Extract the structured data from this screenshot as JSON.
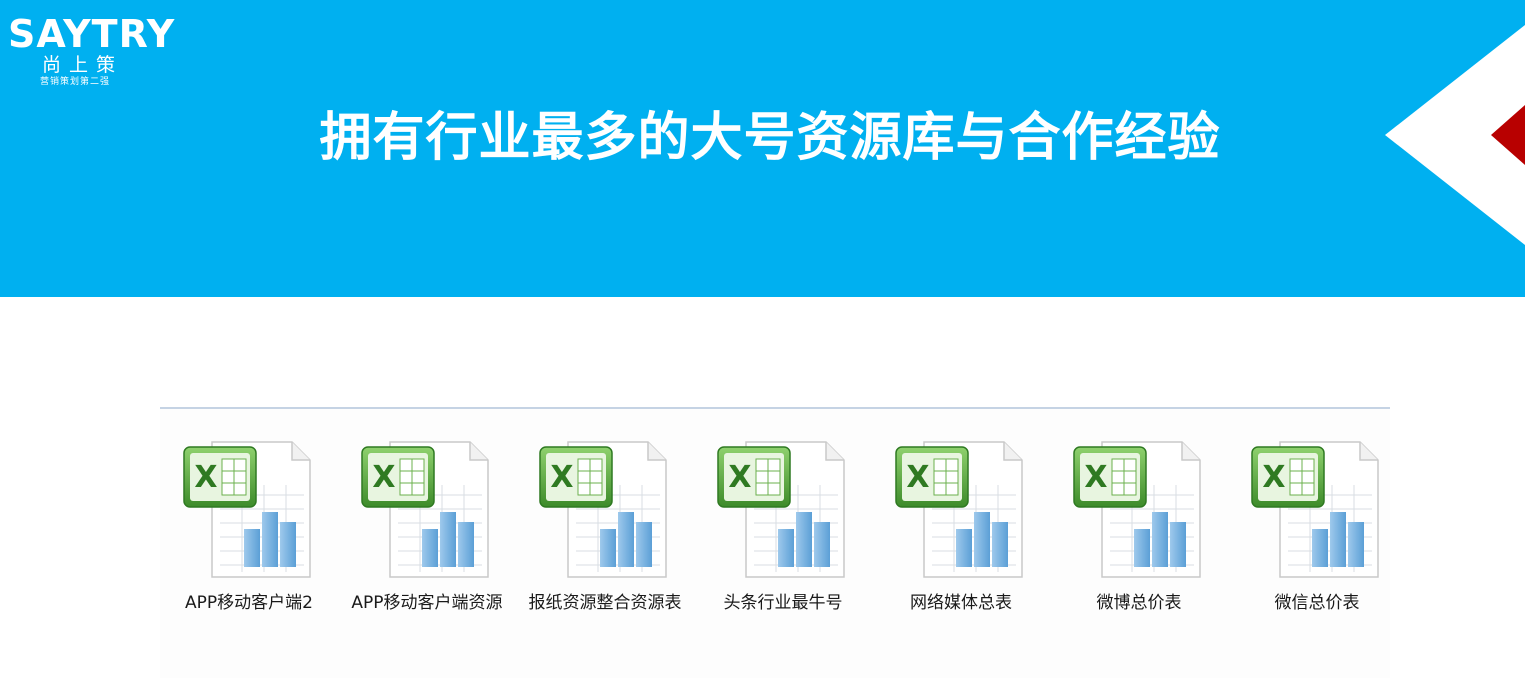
{
  "logo": {
    "brand": "SAYTRY",
    "cn": "尚上策",
    "sub": "营销策划第二强"
  },
  "title": "拥有行业最多的大号资源库与合作经验",
  "colors": {
    "banner": "#00b0f0",
    "accent_red": "#b80000"
  },
  "files": [
    {
      "label": "APP移动客户端2",
      "icon": "excel-file-icon"
    },
    {
      "label": "APP移动客户端资源",
      "icon": "excel-file-icon"
    },
    {
      "label": "报纸资源整合资源表",
      "icon": "excel-file-icon"
    },
    {
      "label": "头条行业最牛号",
      "icon": "excel-file-icon"
    },
    {
      "label": "网络媒体总表",
      "icon": "excel-file-icon"
    },
    {
      "label": "微博总价表",
      "icon": "excel-file-icon"
    },
    {
      "label": "微信总价表",
      "icon": "excel-file-icon"
    }
  ]
}
